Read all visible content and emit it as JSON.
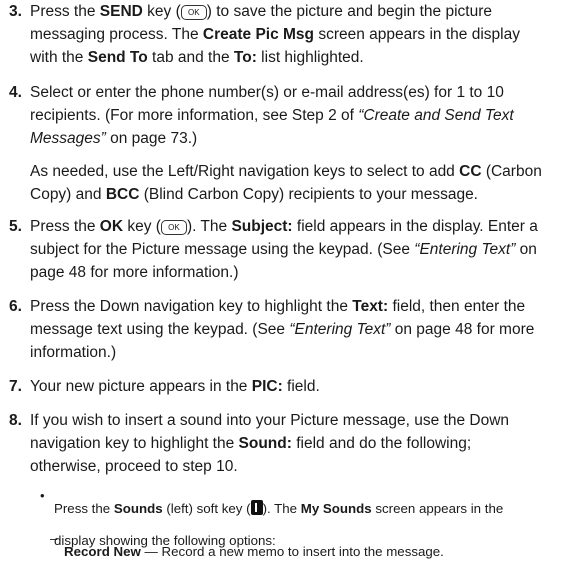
{
  "steps": [
    {
      "num": "3.",
      "lines": [
        [
          {
            "t": "Press the "
          },
          {
            "t": "SEND",
            "b": true
          },
          {
            "t": " key ("
          },
          {
            "key": "ok-key"
          },
          {
            "t": ") to save the picture and begin the picture"
          }
        ],
        [
          {
            "t": "messaging process. The "
          },
          {
            "t": "Create Pic Msg",
            "b": true
          },
          {
            "t": " screen appears in the display"
          }
        ],
        [
          {
            "t": "with the "
          },
          {
            "t": "Send To",
            "b": true
          },
          {
            "t": " tab and the "
          },
          {
            "t": "To:",
            "b": true
          },
          {
            "t": " list highlighted."
          }
        ]
      ]
    },
    {
      "num": "4.",
      "lines": [
        [
          {
            "t": "Select or enter the phone number(s) or e-mail address(es) for 1 to 10"
          }
        ],
        [
          {
            "t": "recipients. (For more information, see Step 2 of "
          },
          {
            "t": "“Create and Send Text",
            "i": true
          }
        ],
        [
          {
            "t": "Messages”",
            "i": true
          },
          {
            "t": " on page 73.)"
          }
        ]
      ],
      "para2": [
        [
          {
            "t": "As needed, use the Left/Right navigation keys to select to add "
          },
          {
            "t": "CC",
            "b": true
          },
          {
            "t": " (Carbon"
          }
        ],
        [
          {
            "t": "Copy) and "
          },
          {
            "t": "BCC",
            "b": true
          },
          {
            "t": " (Blind Carbon Copy) recipients to your message."
          }
        ]
      ]
    },
    {
      "num": "5.",
      "lines": [
        [
          {
            "t": "Press the "
          },
          {
            "t": "OK",
            "b": true
          },
          {
            "t": " key ("
          },
          {
            "key": "ok-key"
          },
          {
            "t": "). The "
          },
          {
            "t": "Subject:",
            "b": true
          },
          {
            "t": " field appears in the display. Enter a"
          }
        ],
        [
          {
            "t": "subject for the Picture message using the keypad. (See "
          },
          {
            "t": "“Entering Text”",
            "i": true
          },
          {
            "t": " on"
          }
        ],
        [
          {
            "t": "page 48 for more information.)"
          }
        ]
      ]
    },
    {
      "num": "6.",
      "lines": [
        [
          {
            "t": "Press the Down navigation key to highlight the "
          },
          {
            "t": "Text:",
            "b": true
          },
          {
            "t": " field, then enter the"
          }
        ],
        [
          {
            "t": "message text using the keypad. (See "
          },
          {
            "t": "“Entering Text”",
            "i": true
          },
          {
            "t": " on page 48 for more"
          }
        ],
        [
          {
            "t": "information.)"
          }
        ]
      ]
    },
    {
      "num": "7.",
      "lines": [
        [
          {
            "t": "Your new picture appears in the "
          },
          {
            "t": "PIC:",
            "b": true
          },
          {
            "t": " field."
          }
        ]
      ]
    },
    {
      "num": "8.",
      "lines": [
        [
          {
            "t": "If you wish to insert a sound into your Picture message, use the Down"
          }
        ],
        [
          {
            "t": "navigation key to highlight the "
          },
          {
            "t": "Sound:",
            "b": true
          },
          {
            "t": " field and do the following;"
          }
        ],
        [
          {
            "t": "otherwise, proceed to step 10."
          }
        ]
      ]
    }
  ],
  "bullet": {
    "lines": [
      [
        {
          "t": "Press the "
        },
        {
          "t": "Sounds",
          "b": true
        },
        {
          "t": " (left) soft key ("
        },
        {
          "key": "soft-key"
        },
        {
          "t": "). The "
        },
        {
          "t": "My Sounds",
          "b": true
        },
        {
          "t": " screen appears in the"
        }
      ],
      [
        {
          "t": "display showing the following options:"
        }
      ]
    ]
  },
  "subbullet": {
    "dash": "–",
    "lines": [
      [
        {
          "t": "Record New",
          "b": true
        },
        {
          "t": " — Record a new memo to insert into the message."
        }
      ]
    ]
  },
  "ok_key_label": "OK"
}
